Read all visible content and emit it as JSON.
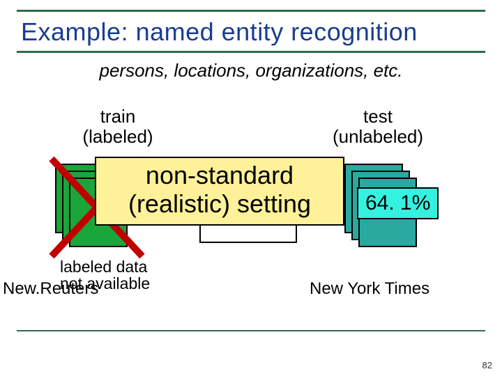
{
  "title": "Example: named entity recognition",
  "subtitle": "persons, locations, organizations, etc.",
  "left_label_line1": "train",
  "left_label_line2": "(labeled)",
  "right_label_line1": "test",
  "right_label_line2": "(unlabeled)",
  "callout_line1": "non-standard",
  "callout_line2": "(realistic) setting",
  "percentage": "64. 1%",
  "labeled_data_line1": "labeled data",
  "labeled_data_line2": "not available",
  "left_source_prefix": "New.",
  "left_source_name": "Reuters",
  "right_source": "New York Times",
  "page_number": "82"
}
